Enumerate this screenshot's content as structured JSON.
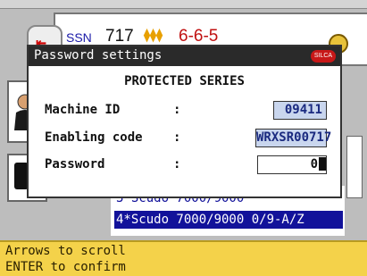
{
  "background": {
    "ssn_label": "SSN",
    "series_number": "717",
    "cuts_icon": "key-cuts-icon",
    "cuts_value": "6-6-5",
    "list_items": [
      "3*Scudo 7000/9000",
      "4*Scudo 7000/9000 0/9-A/Z"
    ]
  },
  "dialog": {
    "title": "Password settings",
    "brand": "SILCA",
    "heading": "PROTECTED SERIES",
    "rows": [
      {
        "label": "Machine ID",
        "colon": ":",
        "value": "09411"
      },
      {
        "label": "Enabling code",
        "colon": ":",
        "value": "WRXSR00717"
      },
      {
        "label": "Password",
        "colon": ":",
        "value": "0"
      }
    ]
  },
  "status": {
    "line1": "Arrows to scroll",
    "line2": "ENTER to confirm"
  },
  "colors": {
    "status_bar": "#f4d24a",
    "titlebar": "#2a2a2a",
    "field_highlight": "#c9d6ee",
    "list_selected": "#12129a"
  }
}
